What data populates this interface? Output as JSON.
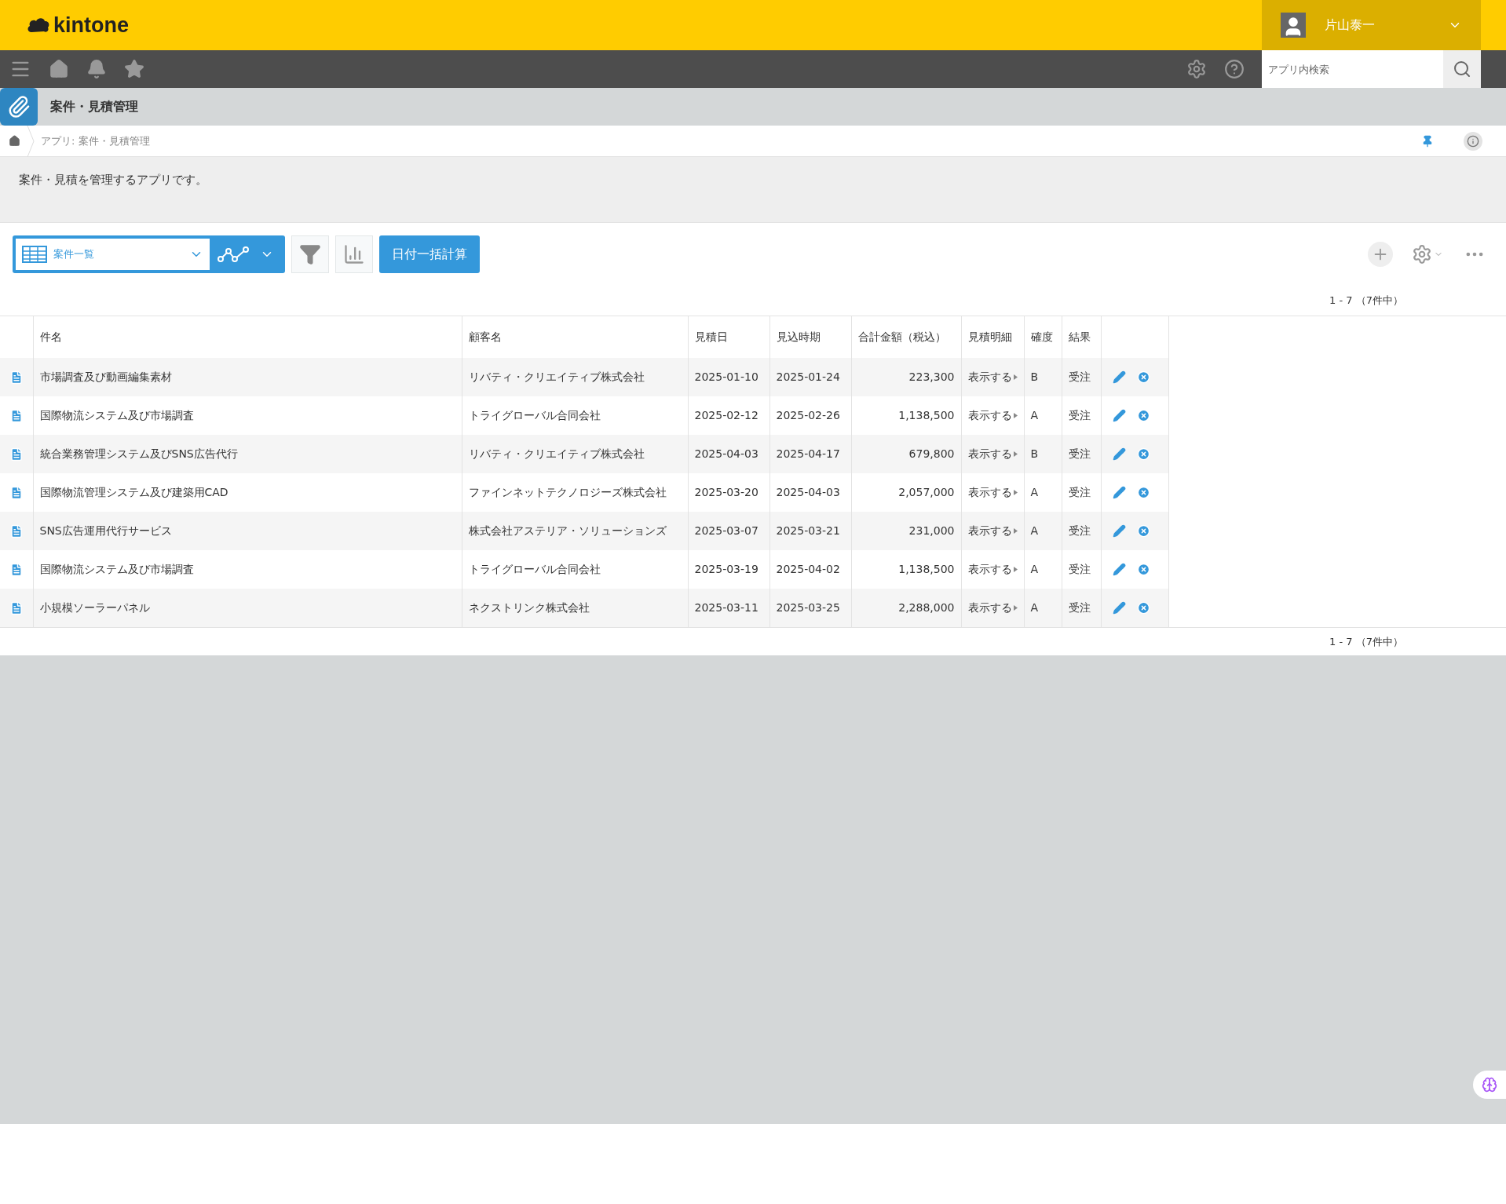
{
  "header": {
    "logo": "kintone",
    "user_name": "片山泰一"
  },
  "search": {
    "placeholder": "アプリ内検索"
  },
  "app": {
    "title": "案件・見積管理",
    "breadcrumb": "アプリ: 案件・見積管理",
    "description": "案件・見積を管理するアプリです。"
  },
  "toolbar": {
    "view": "案件一覧",
    "action_button": "日付一括計算"
  },
  "pagination_top": "1 - 7 （7件中）",
  "table": {
    "columns": [
      "件名",
      "顧客名",
      "見積日",
      "見込時期",
      "合計金額（税込）",
      "見積明細",
      "確度",
      "結果"
    ],
    "rows": [
      {
        "cells": [
          "市場調査及び動画編集素材",
          "リバティ・クリエイティブ株式会社",
          "2025-01-10",
          "2025-01-24",
          "223,300",
          "表示する",
          "B",
          "受注"
        ]
      },
      {
        "cells": [
          "国際物流システム及び市場調査",
          "トライグローバル合同会社",
          "2025-02-12",
          "2025-02-26",
          "1,138,500",
          "表示する",
          "A",
          "受注"
        ]
      },
      {
        "cells": [
          "統合業務管理システム及びSNS広告代行",
          "リバティ・クリエイティブ株式会社",
          "2025-04-03",
          "2025-04-17",
          "679,800",
          "表示する",
          "B",
          "受注"
        ]
      },
      {
        "cells": [
          "国際物流管理システム及び建築用CAD",
          "ファインネットテクノロジーズ株式会社",
          "2025-03-20",
          "2025-04-03",
          "2,057,000",
          "表示する",
          "A",
          "受注"
        ]
      },
      {
        "cells": [
          "SNS広告運用代行サービス",
          "株式会社アステリア・ソリューションズ",
          "2025-03-07",
          "2025-03-21",
          "231,000",
          "表示する",
          "A",
          "受注"
        ]
      },
      {
        "cells": [
          "国際物流システム及び市場調査",
          "トライグローバル合同会社",
          "2025-03-19",
          "2025-04-02",
          "1,138,500",
          "表示する",
          "A",
          "受注"
        ]
      },
      {
        "cells": [
          "小規模ソーラーパネル",
          "ネクストリンク株式会社",
          "2025-03-11",
          "2025-03-25",
          "2,288,000",
          "表示する",
          "A",
          "受注"
        ]
      }
    ]
  },
  "pagination_bottom": "1 - 7 （7件中）"
}
